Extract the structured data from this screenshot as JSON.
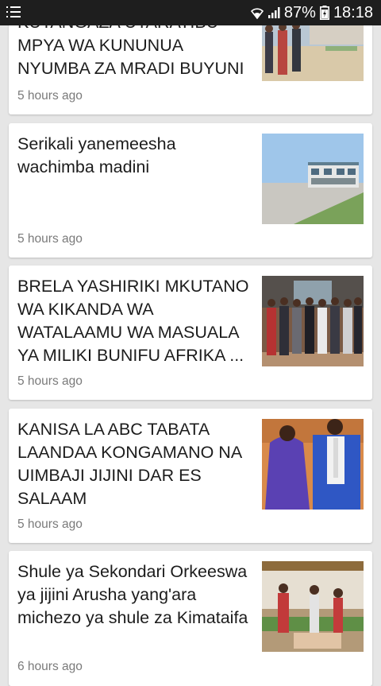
{
  "status_bar": {
    "battery": "87%",
    "time": "18:18"
  },
  "articles": [
    {
      "title": "KUTANGAZA UTARATIBU MPYA WA KUNUNUA NYUMBA ZA MRADI BUYUNI",
      "time": "5 hours ago",
      "image": "officials-walking-photo"
    },
    {
      "title": "Serikali yanemeesha wachimba madini",
      "time": "5 hours ago",
      "image": "building-photo"
    },
    {
      "title": "BRELA YASHIRIKI MKUTANO WA KIKANDA WA WATALAAMU WA MASUALA YA MILIKI BUNIFU AFRIKA ...",
      "time": "5 hours ago",
      "image": "group-photo"
    },
    {
      "title": "KANISA LA ABC TABATA LAANDAA KONGAMANO NA UIMBAJI JIJINI DAR ES SALAAM",
      "time": "5 hours ago",
      "image": "couple-photo"
    },
    {
      "title": "Shule ya Sekondari Orkeeswa ya jijini Arusha yang'ara michezo ya shule za Kimataifa",
      "time": "6 hours ago",
      "image": "school-sports-photo"
    }
  ]
}
